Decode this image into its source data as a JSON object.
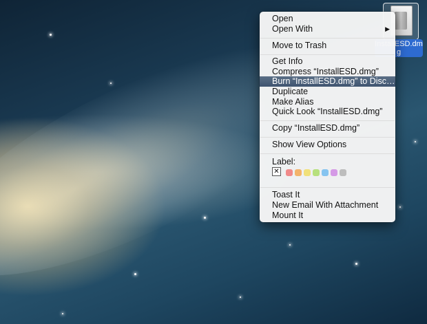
{
  "file": {
    "name_line1": "InstallESD.dm",
    "name_line2": "g"
  },
  "menu": {
    "open": "Open",
    "open_with": "Open With",
    "submenu_arrow": "▶",
    "move_to_trash": "Move to Trash",
    "get_info": "Get Info",
    "compress": "Compress “InstallESD.dmg”",
    "burn": "Burn “InstallESD.dmg” to Disc…",
    "duplicate": "Duplicate",
    "make_alias": "Make Alias",
    "quick_look": "Quick Look “InstallESD.dmg”",
    "copy": "Copy “InstallESD.dmg”",
    "show_view_options": "Show View Options",
    "label_title": "Label:",
    "label_none_symbol": "✕",
    "label_colors": [
      "#f08a8a",
      "#f3b36a",
      "#f1e07a",
      "#b7e07d",
      "#86c4f0",
      "#d59ae6",
      "#bdbdbd"
    ],
    "toast_it": "Toast It",
    "new_email": "New Email With Attachment",
    "mount_it": "Mount It"
  }
}
